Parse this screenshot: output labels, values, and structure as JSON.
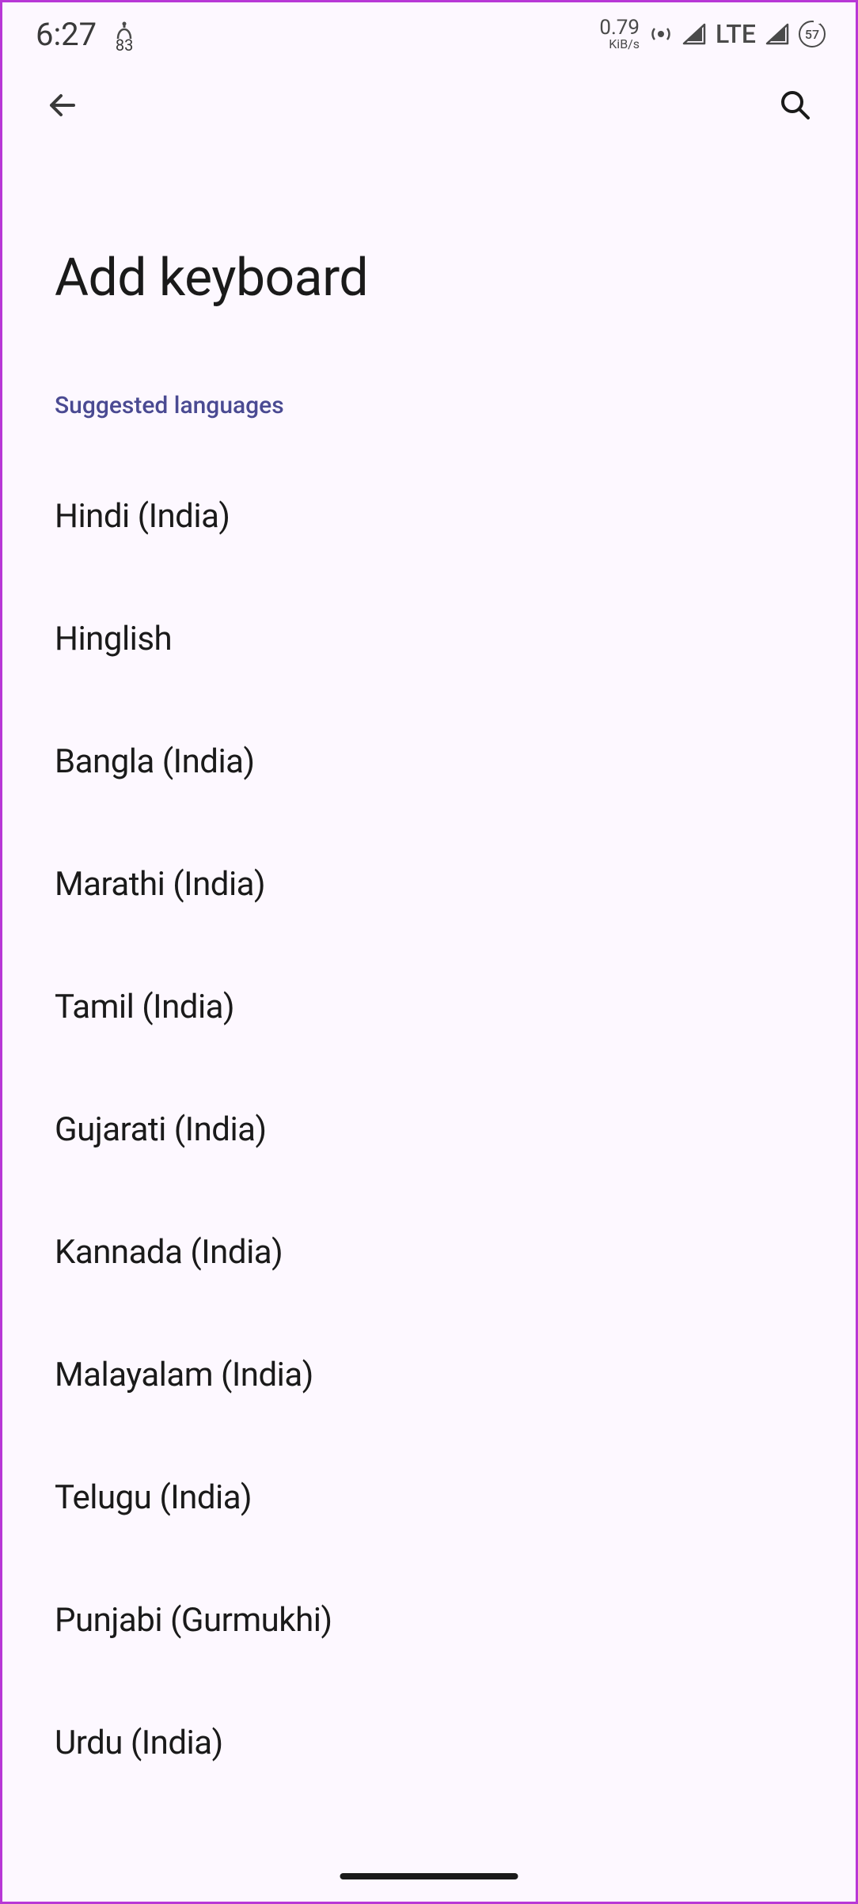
{
  "statusBar": {
    "time": "6:27",
    "lockBadge": "83",
    "dataRateNum": "0.79",
    "dataRateUnit": "KiB/s",
    "networkType": "LTE",
    "battery": "57"
  },
  "appBar": {
    "backIcon": "arrow-back",
    "searchIcon": "search"
  },
  "page": {
    "title": "Add keyboard",
    "sectionHeader": "Suggested languages"
  },
  "languages": [
    "Hindi (India)",
    "Hinglish",
    "Bangla (India)",
    "Marathi (India)",
    "Tamil (India)",
    "Gujarati (India)",
    "Kannada (India)",
    "Malayalam (India)",
    "Telugu (India)",
    "Punjabi (Gurmukhi)",
    "Urdu (India)"
  ]
}
